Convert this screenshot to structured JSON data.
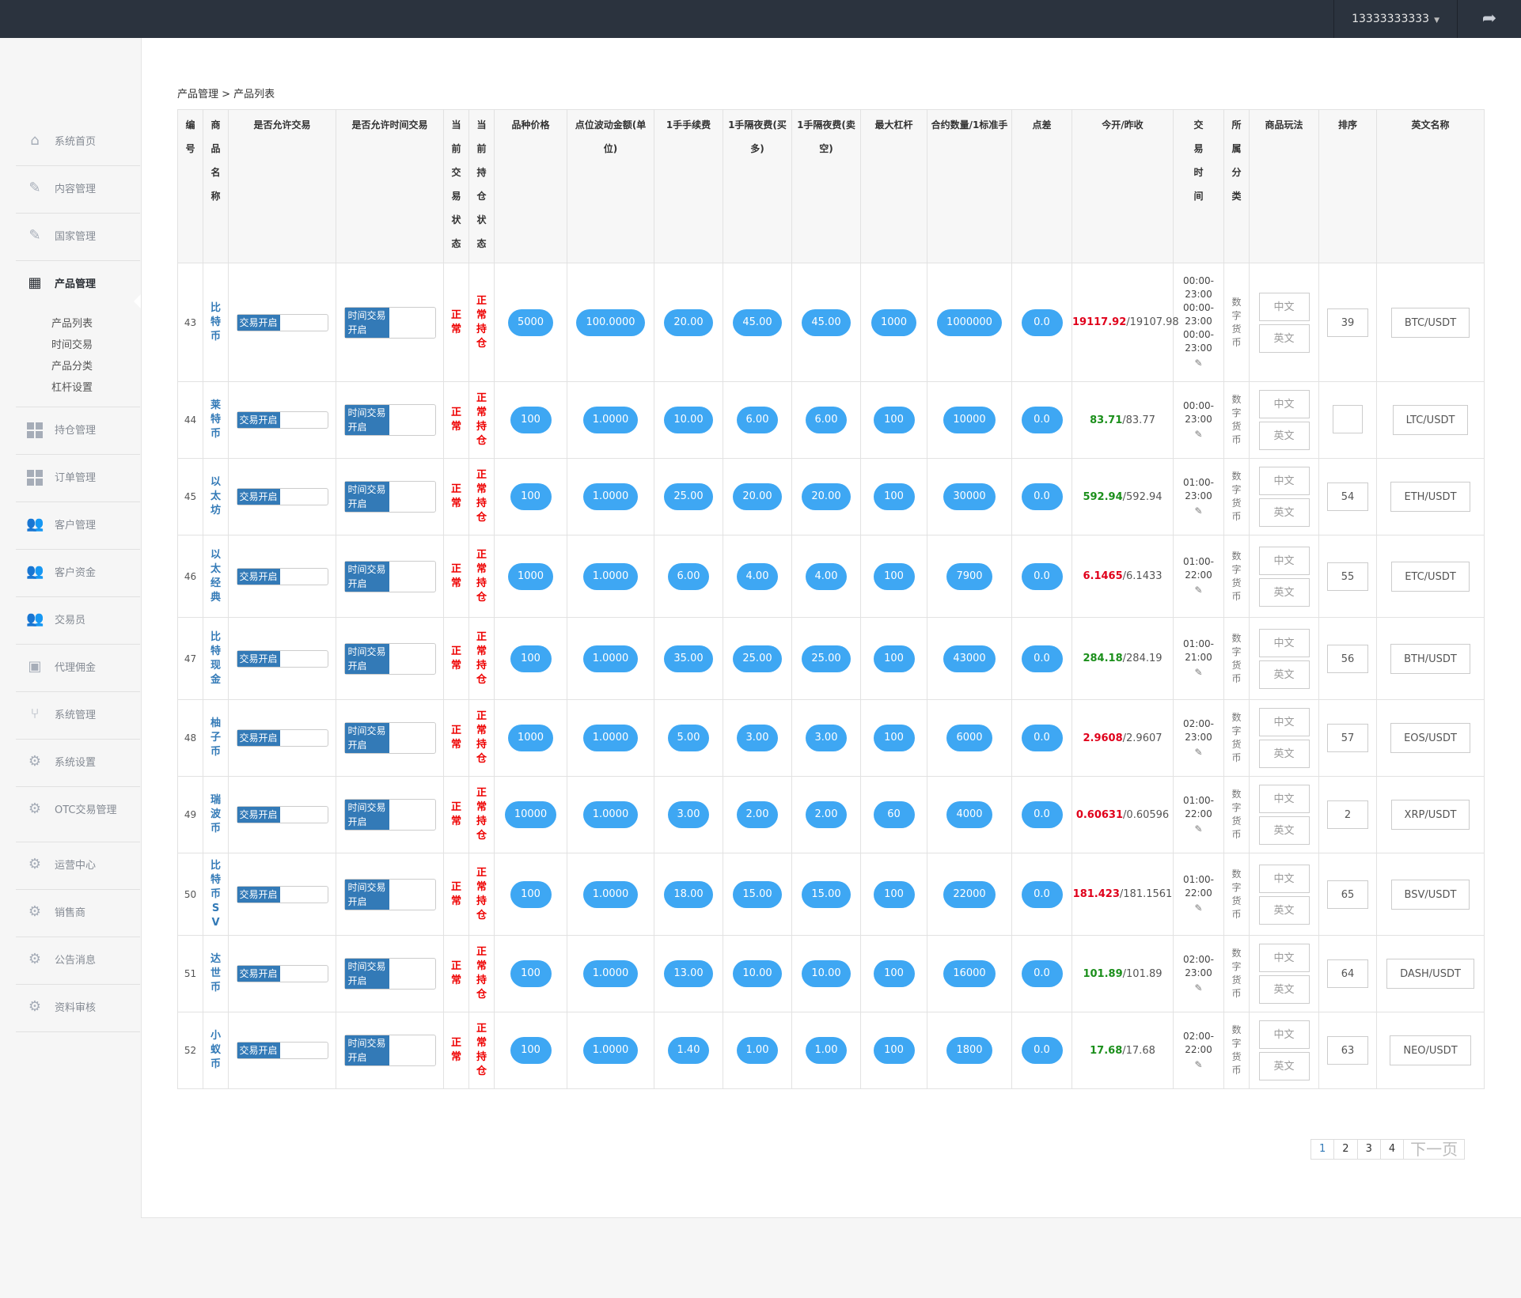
{
  "header": {
    "user": "13333333333",
    "logout_icon": "share-arrow-icon"
  },
  "sidebar": {
    "items": [
      {
        "label": "系统首页",
        "icon": "home-icon"
      },
      {
        "label": "内容管理",
        "icon": "edit-icon"
      },
      {
        "label": "国家管理",
        "icon": "edit-icon"
      },
      {
        "label": "产品管理",
        "icon": "calendar-icon",
        "active": true,
        "sub": [
          "产品列表",
          "时间交易",
          "产品分类",
          "杠杆设置"
        ]
      },
      {
        "label": "持仓管理",
        "icon": "grid-icon"
      },
      {
        "label": "订单管理",
        "icon": "grid-icon"
      },
      {
        "label": "客户管理",
        "icon": "users-icon"
      },
      {
        "label": "客户资金",
        "icon": "users-icon"
      },
      {
        "label": "交易员",
        "icon": "users-icon"
      },
      {
        "label": "代理佣金",
        "icon": "image-icon"
      },
      {
        "label": "系统管理",
        "icon": "branch-icon"
      },
      {
        "label": "系统设置",
        "icon": "gear-icon"
      },
      {
        "label": "OTC交易管理",
        "icon": "gear-icon"
      },
      {
        "label": "运营中心",
        "icon": "gear-icon"
      },
      {
        "label": "销售商",
        "icon": "gear-icon"
      },
      {
        "label": "公告消息",
        "icon": "gear-icon"
      },
      {
        "label": "资料审核",
        "icon": "gear-icon"
      }
    ]
  },
  "breadcrumb": "产品管理 > 产品列表",
  "table": {
    "headers": [
      "编号",
      "商品名称",
      "是否允许交易",
      "是否允许时间交易",
      "当前交易状态",
      "当前持仓状态",
      "品种价格",
      "点位波动金额(单位)",
      "1手手续费",
      "1手隔夜费(买多)",
      "1手隔夜费(卖空)",
      "最大杠杆",
      "合约数量/1标准手",
      "点差",
      "今开/昨收",
      "交易时间",
      "所属分类",
      "商品玩法",
      "排序",
      "英文名称"
    ],
    "trade_label": "交易开启",
    "time_trade_label": "时间交易开启",
    "trade_status": "正常",
    "hold_status": "正常持仓",
    "category": "数字货币",
    "lang_cn": "中文",
    "lang_en": "英文",
    "rows": [
      {
        "id": "43",
        "name": "比特币",
        "price": "5000",
        "tick": "100.0000",
        "fee": "20.00",
        "buy": "45.00",
        "sell": "45.00",
        "lev": "1000",
        "qty": "1000000",
        "spread": "0.0",
        "open": "19117.92",
        "close": "19107.98",
        "dir": "up",
        "time": [
          "00:00-",
          "23:00",
          "00:00-",
          "23:00",
          "00:00-",
          "23:00"
        ],
        "sort": "39",
        "en": "BTC/USDT"
      },
      {
        "id": "44",
        "name": "莱特币",
        "price": "100",
        "tick": "1.0000",
        "fee": "10.00",
        "buy": "6.00",
        "sell": "6.00",
        "lev": "100",
        "qty": "10000",
        "spread": "0.0",
        "open": "83.71",
        "close": "83.77",
        "dir": "dn",
        "time": [
          "00:00-",
          "23:00"
        ],
        "sort": "",
        "en": "LTC/USDT"
      },
      {
        "id": "45",
        "name": "以太坊",
        "price": "100",
        "tick": "1.0000",
        "fee": "25.00",
        "buy": "20.00",
        "sell": "20.00",
        "lev": "100",
        "qty": "30000",
        "spread": "0.0",
        "open": "592.94",
        "close": "592.94",
        "dir": "dn",
        "time": [
          "01:00-",
          "23:00"
        ],
        "sort": "54",
        "en": "ETH/USDT"
      },
      {
        "id": "46",
        "name": "以太经典",
        "price": "1000",
        "tick": "1.0000",
        "fee": "6.00",
        "buy": "4.00",
        "sell": "4.00",
        "lev": "100",
        "qty": "7900",
        "spread": "0.0",
        "open": "6.1465",
        "close": "6.1433",
        "dir": "up",
        "time": [
          "01:00-",
          "22:00"
        ],
        "sort": "55",
        "en": "ETC/USDT"
      },
      {
        "id": "47",
        "name": "比特现金",
        "price": "100",
        "tick": "1.0000",
        "fee": "35.00",
        "buy": "25.00",
        "sell": "25.00",
        "lev": "100",
        "qty": "43000",
        "spread": "0.0",
        "open": "284.18",
        "close": "284.19",
        "dir": "dn",
        "time": [
          "01:00-",
          "21:00"
        ],
        "sort": "56",
        "en": "BTH/USDT"
      },
      {
        "id": "48",
        "name": "柚子币",
        "price": "1000",
        "tick": "1.0000",
        "fee": "5.00",
        "buy": "3.00",
        "sell": "3.00",
        "lev": "100",
        "qty": "6000",
        "spread": "0.0",
        "open": "2.9608",
        "close": "2.9607",
        "dir": "up",
        "time": [
          "02:00-",
          "23:00"
        ],
        "sort": "57",
        "en": "EOS/USDT"
      },
      {
        "id": "49",
        "name": "瑞波币",
        "price": "10000",
        "tick": "1.0000",
        "fee": "3.00",
        "buy": "2.00",
        "sell": "2.00",
        "lev": "60",
        "qty": "4000",
        "spread": "0.0",
        "open": "0.60631",
        "close": "0.60596",
        "dir": "up",
        "time": [
          "01:00-",
          "22:00"
        ],
        "sort": "2",
        "en": "XRP/USDT"
      },
      {
        "id": "50",
        "name": "比特币SV",
        "price": "100",
        "tick": "1.0000",
        "fee": "18.00",
        "buy": "15.00",
        "sell": "15.00",
        "lev": "100",
        "qty": "22000",
        "spread": "0.0",
        "open": "181.423",
        "close": "181.1561",
        "dir": "up",
        "time": [
          "01:00-",
          "22:00"
        ],
        "sort": "65",
        "en": "BSV/USDT"
      },
      {
        "id": "51",
        "name": "达世币",
        "price": "100",
        "tick": "1.0000",
        "fee": "13.00",
        "buy": "10.00",
        "sell": "10.00",
        "lev": "100",
        "qty": "16000",
        "spread": "0.0",
        "open": "101.89",
        "close": "101.89",
        "dir": "dn",
        "time": [
          "02:00-",
          "23:00"
        ],
        "sort": "64",
        "en": "DASH/USDT"
      },
      {
        "id": "52",
        "name": "小蚁币",
        "price": "100",
        "tick": "1.0000",
        "fee": "1.40",
        "buy": "1.00",
        "sell": "1.00",
        "lev": "100",
        "qty": "1800",
        "spread": "0.0",
        "open": "17.68",
        "close": "17.68",
        "dir": "dn",
        "time": [
          "02:00-",
          "22:00"
        ],
        "sort": "63",
        "en": "NEO/USDT"
      }
    ]
  },
  "pagination": {
    "pages": [
      "1",
      "2",
      "3",
      "4"
    ],
    "current": "1",
    "next": "下一页"
  },
  "colors": {
    "topbar": "#2b333e",
    "pill": "#3ea7f3",
    "switch": "#337ab7",
    "up": "#e0001b",
    "down": "#1b8f1b"
  }
}
